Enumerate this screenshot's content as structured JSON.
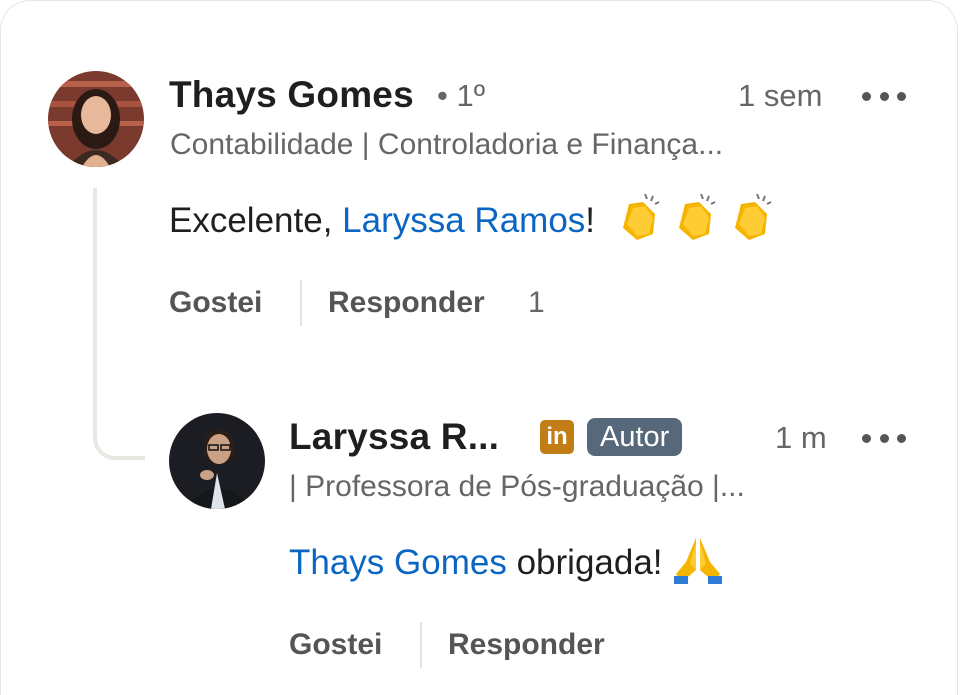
{
  "comments": [
    {
      "author": "Thays Gomes",
      "degree": "• 1º",
      "time": "1 sem",
      "headline": "Contabilidade | Controladoria e Finança...",
      "text_prefix": "Excelente, ",
      "mention": "Laryssa Ramos",
      "text_suffix": "!",
      "emoji": [
        "clapping-hands",
        "clapping-hands",
        "clapping-hands"
      ],
      "like_label": "Gostei",
      "reply_label": "Responder",
      "reply_count": "1"
    },
    {
      "author": "Laryssa R...",
      "badge": "Autor",
      "time": "1 m",
      "headline": "| Professora de Pós-graduação |...",
      "mention": "Thays Gomes",
      "text_suffix": " obrigada! ",
      "emoji": [
        "folded-hands"
      ],
      "like_label": "Gostei",
      "reply_label": "Responder"
    }
  ],
  "colors": {
    "mention": "#0a66c2",
    "badge_bg": "#56687a",
    "linkedin_icon": "#c37d16",
    "thread_line": "#e8e7e2"
  }
}
